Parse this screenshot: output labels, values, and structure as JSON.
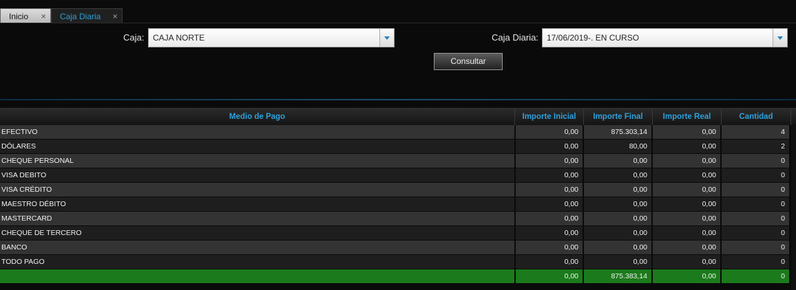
{
  "tabs": [
    {
      "label": "Inicio",
      "close": "×"
    },
    {
      "label": "Caja Diaria",
      "close": "×"
    }
  ],
  "form": {
    "caja_label": "Caja:",
    "caja_value": "CAJA NORTE",
    "caja_diaria_label": "Caja Diaria:",
    "caja_diaria_value": "17/06/2019-. EN CURSO",
    "consultar_label": "Consultar"
  },
  "table": {
    "headers": [
      "Medio de Pago",
      "Importe Inicial",
      "Importe Final",
      "Importe Real",
      "Cantidad"
    ],
    "rows": [
      {
        "medio": "EFECTIVO",
        "inicial": "0,00",
        "final": "875.303,14",
        "real": "0,00",
        "cantidad": "4"
      },
      {
        "medio": "DÓLARES",
        "inicial": "0,00",
        "final": "80,00",
        "real": "0,00",
        "cantidad": "2"
      },
      {
        "medio": "CHEQUE PERSONAL",
        "inicial": "0,00",
        "final": "0,00",
        "real": "0,00",
        "cantidad": "0"
      },
      {
        "medio": "VISA DEBITO",
        "inicial": "0,00",
        "final": "0,00",
        "real": "0,00",
        "cantidad": "0"
      },
      {
        "medio": "VISA CRÉDITO",
        "inicial": "0,00",
        "final": "0,00",
        "real": "0,00",
        "cantidad": "0"
      },
      {
        "medio": "MAESTRO DÉBITO",
        "inicial": "0,00",
        "final": "0,00",
        "real": "0,00",
        "cantidad": "0"
      },
      {
        "medio": "MASTERCARD",
        "inicial": "0,00",
        "final": "0,00",
        "real": "0,00",
        "cantidad": "0"
      },
      {
        "medio": "CHEQUE DE TERCERO",
        "inicial": "0,00",
        "final": "0,00",
        "real": "0,00",
        "cantidad": "0"
      },
      {
        "medio": "BANCO",
        "inicial": "0,00",
        "final": "0,00",
        "real": "0,00",
        "cantidad": "0"
      },
      {
        "medio": "TODO PAGO",
        "inicial": "0,00",
        "final": "0,00",
        "real": "0,00",
        "cantidad": "0"
      }
    ],
    "total": {
      "medio": "",
      "inicial": "0,00",
      "final": "875.383,14",
      "real": "0,00",
      "cantidad": "0"
    }
  },
  "colors": {
    "accent": "#2ea0dc",
    "total_row": "#1b7a1b"
  }
}
